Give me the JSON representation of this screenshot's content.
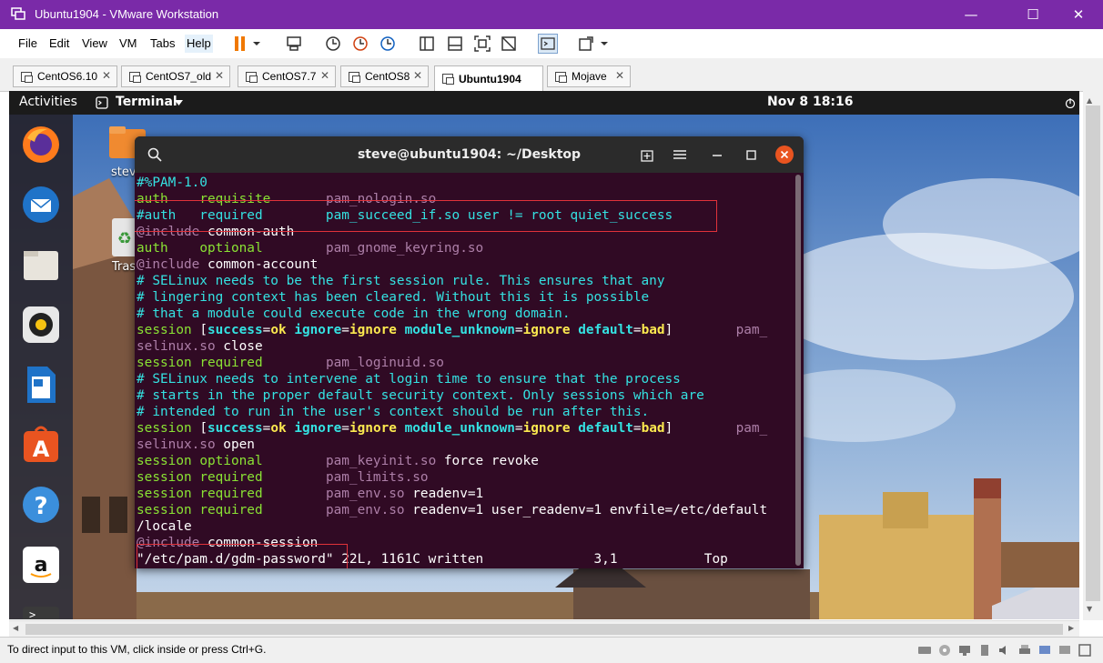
{
  "window": {
    "title": "Ubuntu1904 - VMware Workstation",
    "menu": [
      "File",
      "Edit",
      "View",
      "VM",
      "Tabs",
      "Help"
    ]
  },
  "vm_tabs": [
    {
      "label": "CentOS6.10",
      "active": false
    },
    {
      "label": "CentOS7_old",
      "active": false
    },
    {
      "label": "CentOS7.7",
      "active": false
    },
    {
      "label": "CentOS8",
      "active": false
    },
    {
      "label": "Ubuntu1904",
      "active": true
    },
    {
      "label": "Mojave",
      "active": false
    }
  ],
  "gnome": {
    "activities": "Activities",
    "app_menu": "Terminal",
    "clock": "Nov 8  18:16",
    "desktop_icons": [
      "stev",
      "Tras"
    ]
  },
  "terminal": {
    "title": "steve@ubuntu1904: ~/Desktop",
    "lines": [
      [
        {
          "t": "#%PAM-1.0",
          "c": "cm"
        }
      ],
      [
        {
          "t": "auth    ",
          "c": "gr"
        },
        {
          "t": "requisite       ",
          "c": "gr"
        },
        {
          "t": "pam_nologin.so",
          "c": "mg"
        }
      ],
      [
        {
          "t": "#auth   required        pam_succeed_if.so user != root quiet_success",
          "c": "cm"
        }
      ],
      [
        {
          "t": "@include",
          "c": "mg"
        },
        {
          "t": " common-auth",
          "c": ""
        }
      ],
      [
        {
          "t": "auth    ",
          "c": "gr"
        },
        {
          "t": "optional        ",
          "c": "gr"
        },
        {
          "t": "pam_gnome_keyring.so",
          "c": "mg"
        }
      ],
      [
        {
          "t": "@include",
          "c": "mg"
        },
        {
          "t": " common-account",
          "c": ""
        }
      ],
      [
        {
          "t": "# SELinux needs to be the first session rule. This ensures that any",
          "c": "cm"
        }
      ],
      [
        {
          "t": "# lingering context has been cleared. Without this it is possible",
          "c": "cm"
        }
      ],
      [
        {
          "t": "# that a module could execute code in the wrong domain.",
          "c": "cm"
        }
      ],
      [
        {
          "t": "session ",
          "c": "gr"
        },
        {
          "t": "[",
          "c": ""
        },
        {
          "t": "success",
          "c": "kw bd"
        },
        {
          "t": "=",
          "c": ""
        },
        {
          "t": "ok",
          "c": "yl bd"
        },
        {
          "t": " ",
          "c": ""
        },
        {
          "t": "ignore",
          "c": "kw bd"
        },
        {
          "t": "=",
          "c": ""
        },
        {
          "t": "ignore",
          "c": "yl bd"
        },
        {
          "t": " ",
          "c": ""
        },
        {
          "t": "module_unknown",
          "c": "kw bd"
        },
        {
          "t": "=",
          "c": ""
        },
        {
          "t": "ignore",
          "c": "yl bd"
        },
        {
          "t": " ",
          "c": ""
        },
        {
          "t": "default",
          "c": "kw bd"
        },
        {
          "t": "=",
          "c": ""
        },
        {
          "t": "bad",
          "c": "yl bd"
        },
        {
          "t": "]        ",
          "c": ""
        },
        {
          "t": "pam_",
          "c": "mg"
        }
      ],
      [
        {
          "t": "selinux.so",
          "c": "mg"
        },
        {
          "t": " close",
          "c": ""
        }
      ],
      [
        {
          "t": "session ",
          "c": "gr"
        },
        {
          "t": "required        ",
          "c": "gr"
        },
        {
          "t": "pam_loginuid.so",
          "c": "mg"
        }
      ],
      [
        {
          "t": "# SELinux needs to intervene at login time to ensure that the process",
          "c": "cm"
        }
      ],
      [
        {
          "t": "# starts in the proper default security context. Only sessions which are",
          "c": "cm"
        }
      ],
      [
        {
          "t": "# intended to run in the user's context should be run after this.",
          "c": "cm"
        }
      ],
      [
        {
          "t": "session ",
          "c": "gr"
        },
        {
          "t": "[",
          "c": ""
        },
        {
          "t": "success",
          "c": "kw bd"
        },
        {
          "t": "=",
          "c": ""
        },
        {
          "t": "ok",
          "c": "yl bd"
        },
        {
          "t": " ",
          "c": ""
        },
        {
          "t": "ignore",
          "c": "kw bd"
        },
        {
          "t": "=",
          "c": ""
        },
        {
          "t": "ignore",
          "c": "yl bd"
        },
        {
          "t": " ",
          "c": ""
        },
        {
          "t": "module_unknown",
          "c": "kw bd"
        },
        {
          "t": "=",
          "c": ""
        },
        {
          "t": "ignore",
          "c": "yl bd"
        },
        {
          "t": " ",
          "c": ""
        },
        {
          "t": "default",
          "c": "kw bd"
        },
        {
          "t": "=",
          "c": ""
        },
        {
          "t": "bad",
          "c": "yl bd"
        },
        {
          "t": "]        ",
          "c": ""
        },
        {
          "t": "pam_",
          "c": "mg"
        }
      ],
      [
        {
          "t": "selinux.so",
          "c": "mg"
        },
        {
          "t": " open",
          "c": ""
        }
      ],
      [
        {
          "t": "session ",
          "c": "gr"
        },
        {
          "t": "optional        ",
          "c": "gr"
        },
        {
          "t": "pam_keyinit.so",
          "c": "mg"
        },
        {
          "t": " force revoke",
          "c": ""
        }
      ],
      [
        {
          "t": "session ",
          "c": "gr"
        },
        {
          "t": "required        ",
          "c": "gr"
        },
        {
          "t": "pam_limits.so",
          "c": "mg"
        }
      ],
      [
        {
          "t": "session ",
          "c": "gr"
        },
        {
          "t": "required        ",
          "c": "gr"
        },
        {
          "t": "pam_env.so",
          "c": "mg"
        },
        {
          "t": " readenv=1",
          "c": ""
        }
      ],
      [
        {
          "t": "session ",
          "c": "gr"
        },
        {
          "t": "required        ",
          "c": "gr"
        },
        {
          "t": "pam_env.so",
          "c": "mg"
        },
        {
          "t": " readenv=1 user_readenv=1 envfile=/etc/default",
          "c": ""
        }
      ],
      [
        {
          "t": "/locale",
          "c": ""
        }
      ],
      [
        {
          "t": "@include",
          "c": "mg"
        },
        {
          "t": " common-session",
          "c": ""
        }
      ],
      [
        {
          "t": "\"/etc/pam.d/gdm-password\" 22L, 1161C written              3,1           Top",
          "c": ""
        }
      ]
    ]
  },
  "status": {
    "text": "To direct input to this VM, click inside or press Ctrl+G."
  },
  "colors": {
    "titlebar": "#7a2aa8",
    "terminal_bg": "#300a24",
    "highlight_box": "#e0323a"
  }
}
